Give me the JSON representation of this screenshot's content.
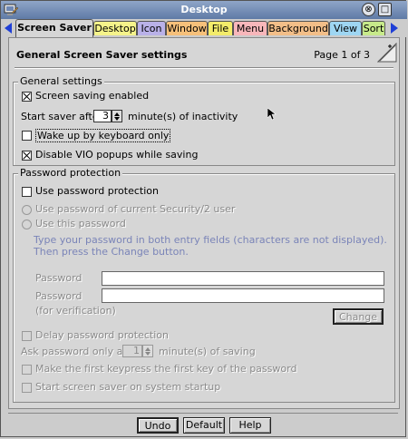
{
  "window": {
    "title": "Desktop",
    "minimize_glyph": "⊗",
    "maximize_glyph": "□"
  },
  "tabs": [
    {
      "label": "Screen Saver",
      "color": "#d6d6d6",
      "active": true
    },
    {
      "label": "Desktop",
      "color": "#f5f38a",
      "active": false
    },
    {
      "label": "Icon",
      "color": "#b9b1e8",
      "active": false
    },
    {
      "label": "Window",
      "color": "#f6c07a",
      "active": false
    },
    {
      "label": "File",
      "color": "#f3ec6a",
      "active": false
    },
    {
      "label": "Menu",
      "color": "#f7b6ba",
      "active": false
    },
    {
      "label": "Background",
      "color": "#f2be88",
      "active": false
    },
    {
      "label": "View",
      "color": "#9ed6f2",
      "active": false
    },
    {
      "label": "Sort",
      "color": "#c7ea8a",
      "active": false
    }
  ],
  "panel": {
    "title": "General Screen Saver settings",
    "page_label": "Page 1 of 3"
  },
  "general": {
    "label": "General settings",
    "screen_saving": {
      "label": "Screen saving enabled",
      "checked": true
    },
    "start_after": {
      "prefix": "Start saver after",
      "value": "3",
      "suffix": "minute(s) of inactivity"
    },
    "wake_keyboard": {
      "label": "Wake up by keyboard only",
      "checked": false
    },
    "disable_vio": {
      "label": "Disable VIO popups while saving",
      "checked": true
    }
  },
  "password": {
    "label": "Password protection",
    "use_password": {
      "label": "Use password protection",
      "checked": false
    },
    "radio_security": "Use password of current Security/2 user",
    "radio_this": "Use this password",
    "info": "Type your password in both entry fields (characters are not displayed). Then press the Change button.",
    "password_label": "Password",
    "password2_label": "Password",
    "verification_label": "(for verification)",
    "change_button": "Change",
    "delay": {
      "label": "Delay password protection"
    },
    "ask_after": {
      "prefix": "Ask password only after",
      "value": "1",
      "suffix": "minute(s) of saving"
    },
    "first_key": {
      "label": "Make the first keypress the first key of the password"
    },
    "startup": {
      "label": "Start screen saver on system startup"
    }
  },
  "buttons": {
    "undo": "Undo",
    "default": "Default",
    "help": "Help"
  },
  "colors": {
    "titlebar": "#6f88b4",
    "arrow": "#1f3fd6",
    "info_text": "#7a84b8"
  }
}
